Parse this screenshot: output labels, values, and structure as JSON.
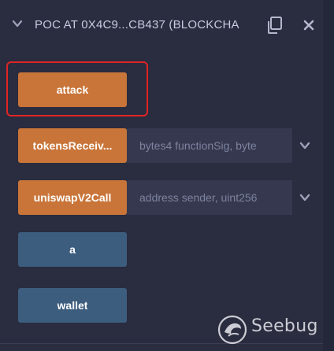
{
  "header": {
    "title": "POC AT 0X4C9...CB437 (BLOCKCHA",
    "collapse_icon": "chevron-down-icon",
    "copy_icon": "copy-icon",
    "close_icon": "close-icon"
  },
  "functions": [
    {
      "label": "attack",
      "kind": "transact",
      "highlighted": true
    },
    {
      "label": "tokensReceiv...",
      "kind": "transact",
      "input_placeholder": "bytes4 functionSig, byte"
    },
    {
      "label": "uniswapV2Call",
      "kind": "transact",
      "input_placeholder": "address sender, uint256"
    },
    {
      "label": "a",
      "kind": "call"
    },
    {
      "label": "wallet",
      "kind": "call"
    }
  ],
  "watermark": {
    "text": "Seebug"
  },
  "colors": {
    "background": "#2a2c3f",
    "transact_button": "#c97539",
    "call_button": "#3d5d7e",
    "highlight_border": "#e02424",
    "input_background": "#35384f"
  }
}
